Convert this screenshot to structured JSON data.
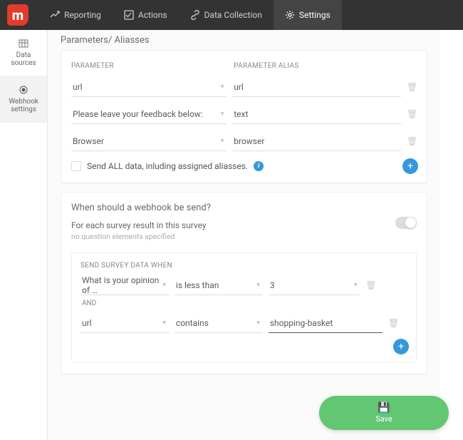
{
  "logo_letter": "m",
  "nav": [
    {
      "label": "Reporting"
    },
    {
      "label": "Actions"
    },
    {
      "label": "Data Collection"
    },
    {
      "label": "Settings"
    }
  ],
  "sidebar": {
    "items": [
      {
        "label": "Data sources"
      },
      {
        "label": "Webhook settings"
      }
    ]
  },
  "params_card": {
    "title": "Parameters/ Aliasses",
    "head_param": "PARAMETER",
    "head_alias": "PARAMETER ALIAS",
    "rows": [
      {
        "param": "url",
        "alias": "url"
      },
      {
        "param": "Please leave your feedback below:",
        "alias": "text"
      },
      {
        "param": "Browser",
        "alias": "browser"
      }
    ],
    "send_all_label": "Send ALL data, inluding assigned aliasses."
  },
  "when_card": {
    "title": "When should a webhook be send?",
    "each_label": "For each survey result in this survey",
    "each_note": "no question elements specified",
    "send_when": "SEND SURVEY DATA WHEN",
    "and_label": "AND",
    "cond1": {
      "field": "What is your opinion of …",
      "op": "is less than",
      "val": "3"
    },
    "cond2": {
      "field": "url",
      "op": "contains",
      "val": "shopping-basket"
    }
  },
  "save_label": "Save"
}
